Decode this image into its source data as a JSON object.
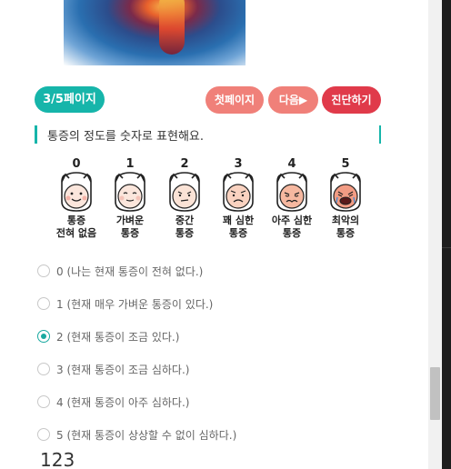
{
  "header": {
    "page_indicator": "3/5페이지",
    "first_page_label": "첫페이지",
    "next_label": "다음▶",
    "diagnose_label": "진단하기"
  },
  "question": "통증의 정도를 숫자로 표현해요.",
  "faces": [
    {
      "num": "0",
      "line1": "통증",
      "line2": "전혀 없음"
    },
    {
      "num": "1",
      "line1": "가벼운",
      "line2": "통증"
    },
    {
      "num": "2",
      "line1": "중간",
      "line2": "통증"
    },
    {
      "num": "3",
      "line1": "꽤 심한",
      "line2": "통증"
    },
    {
      "num": "4",
      "line1": "아주 심한",
      "line2": "통증"
    },
    {
      "num": "5",
      "line1": "최악의",
      "line2": "통증"
    }
  ],
  "options": [
    {
      "label": "0 (나는 현재 통증이 전혀 없다.)",
      "checked": false
    },
    {
      "label": "1 (현재 매우 가벼운 통증이 있다.)",
      "checked": false
    },
    {
      "label": "2 (현재 통증이 조금 있다.)",
      "checked": true
    },
    {
      "label": "3 (현재 통증이 조금 심하다.)",
      "checked": false
    },
    {
      "label": "4 (현재 통증이 아주 심하다.)",
      "checked": false
    },
    {
      "label": "5 (현재 통증이 상상할 수 없이 심하다.)",
      "checked": false
    }
  ],
  "bottom_value": "123",
  "colors": {
    "accent": "#16b5aa",
    "pink_button": "#f08079",
    "red_button": "#e03a4a"
  }
}
